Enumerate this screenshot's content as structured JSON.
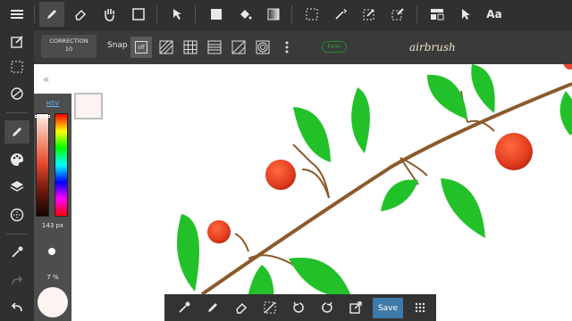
{
  "top_toolbar": {
    "icons": [
      "menu-icon",
      "pencil-icon",
      "eraser-icon",
      "hand-icon",
      "square-icon",
      "move-icon",
      "filled-square-icon",
      "fill-bucket-icon",
      "gradient-icon",
      "selection-icon",
      "magic-wand-icon",
      "edit-selection-icon",
      "selection-pen-icon",
      "layout-icon",
      "cursor-icon"
    ],
    "text_label": "Aa"
  },
  "sub_toolbar": {
    "correction_label": "CORRECTION",
    "correction_value": "10",
    "snap_label": "Snap",
    "snap_off_label": "off",
    "brush_name": "airbrush",
    "badge_text": "Form"
  },
  "color_panel": {
    "mode_label": "HSV",
    "brush_size": "143 px",
    "opacity": "7 %",
    "current_color": "#fbf4f0"
  },
  "bottom_toolbar": {
    "save_label": "Save"
  },
  "colors": {
    "accent": "#3f79a8",
    "leaf": "#22c12a",
    "berry": "#e84a2d",
    "branch": "#8b5a2b"
  }
}
